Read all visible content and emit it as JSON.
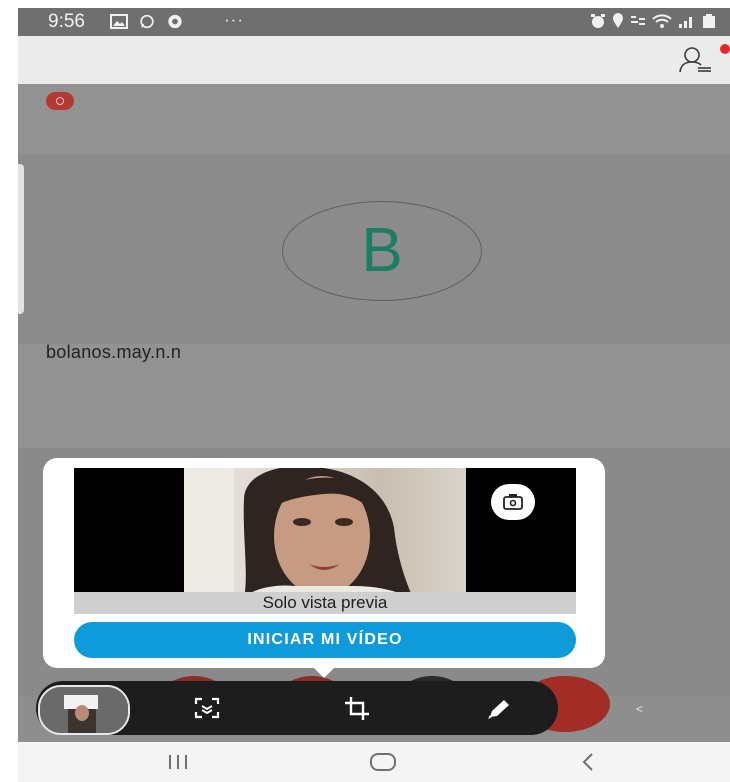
{
  "status_bar": {
    "time": "9:56",
    "more_indicator": "···",
    "icons": [
      "gallery-icon",
      "whatsapp-icon",
      "chrome-icon",
      "alarm-icon",
      "location-icon",
      "volte-icon",
      "wifi-icon",
      "signal-icon",
      "battery-icon"
    ]
  },
  "header": {
    "icons": [
      "participants-icon",
      "notification-dot"
    ]
  },
  "participant": {
    "initial": "B",
    "name": "bolanos.may.n.n"
  },
  "preview_popup": {
    "caption": "Solo vista previa",
    "start_button": "INICIAR MI VÍDEO",
    "icons": [
      "switch-camera-icon"
    ]
  },
  "toolbar": {
    "icons": [
      "self-view-thumbnail",
      "screen-capture-icon",
      "crop-icon",
      "pen-icon",
      "collapse-chevron"
    ]
  },
  "colors": {
    "accent_blue": "#0f9ad9",
    "avatar_letter": "#1b7d64",
    "record_red": "#b33a33",
    "notification_red": "#e6262a",
    "toolbar_dark": "#1d1d1d"
  }
}
